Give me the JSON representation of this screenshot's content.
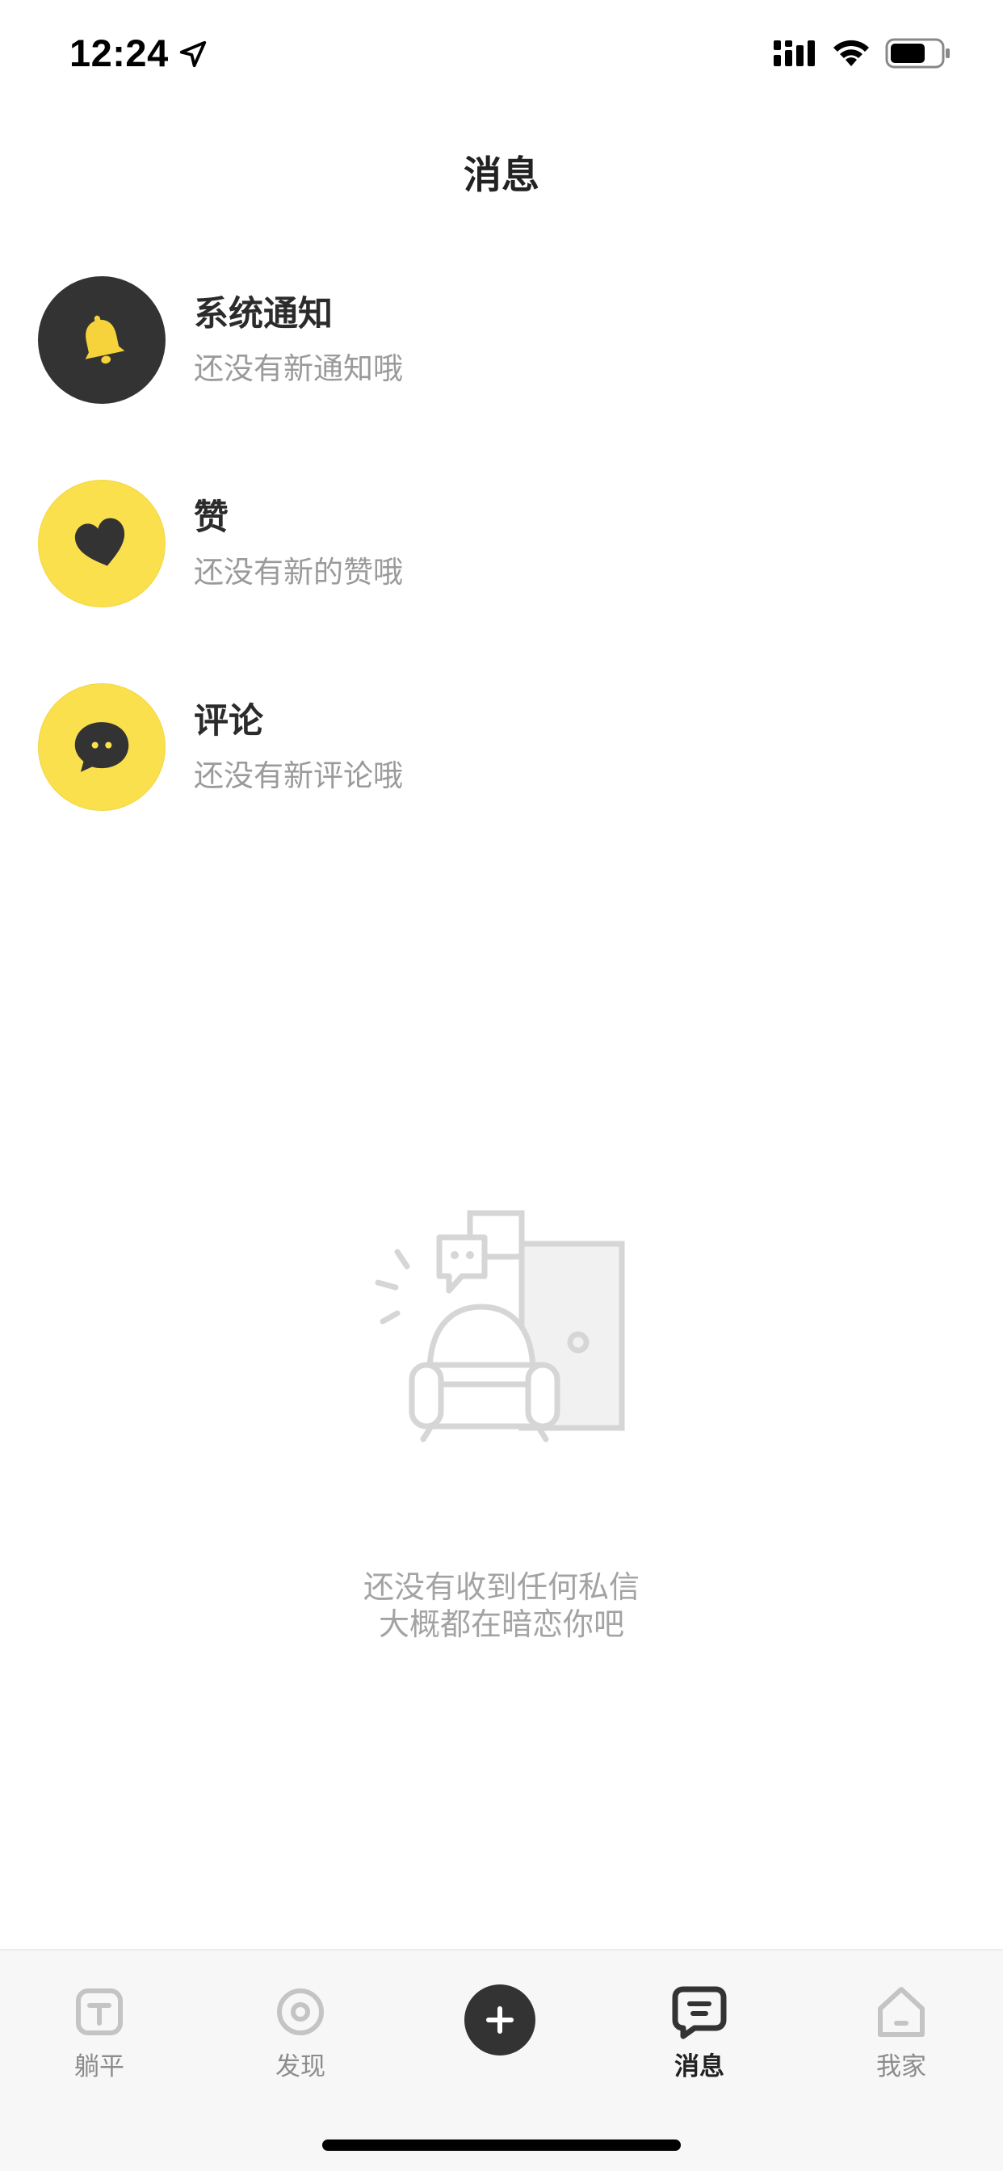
{
  "status_bar": {
    "time": "12:24"
  },
  "header": {
    "title": "消息"
  },
  "categories": [
    {
      "title": "系统通知",
      "subtitle": "还没有新通知哦",
      "icon": "bell-icon",
      "color": "#333333"
    },
    {
      "title": "赞",
      "subtitle": "还没有新的赞哦",
      "icon": "heart-icon",
      "color": "#fbe04e"
    },
    {
      "title": "评论",
      "subtitle": "还没有新评论哦",
      "icon": "comment-icon",
      "color": "#fbe04e"
    }
  ],
  "empty_state": {
    "line1": "还没有收到任何私信",
    "line2": "大概都在暗恋你吧"
  },
  "tab_bar": {
    "items": [
      {
        "label": "躺平",
        "icon": "tangping-icon",
        "active": false
      },
      {
        "label": "发现",
        "icon": "discover-icon",
        "active": false
      },
      {
        "label": "",
        "icon": "plus-icon",
        "active": false
      },
      {
        "label": "消息",
        "icon": "message-icon",
        "active": true
      },
      {
        "label": "我家",
        "icon": "home-icon",
        "active": false
      }
    ]
  },
  "colors": {
    "accent_yellow": "#fbe04e",
    "dark": "#333333",
    "muted_text": "#9a9a9a"
  }
}
